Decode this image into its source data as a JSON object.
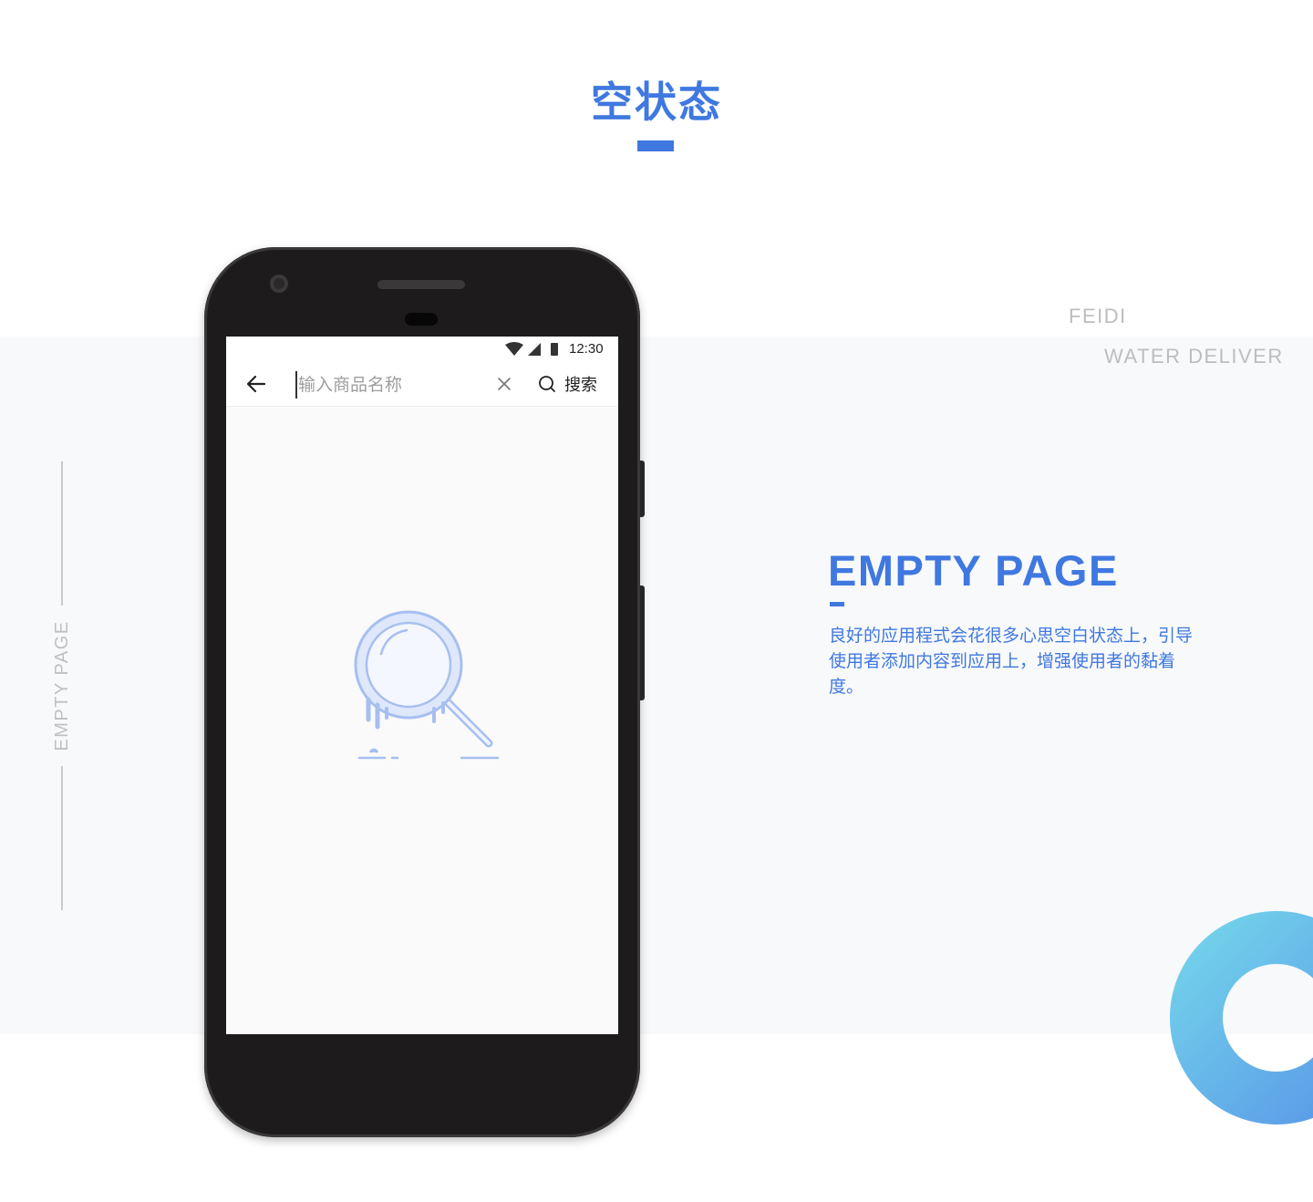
{
  "header": {
    "title": "空状态"
  },
  "brand": {
    "line1": "FEIDI",
    "line2": "WATER DELIVER"
  },
  "side_label": "EMPTY PAGE",
  "section": {
    "heading": "EMPTY PAGE",
    "description": "良好的应用程式会花很多心思空白状态上，引导使用者添加内容到应用上，增强使用者的黏着度。"
  },
  "phone": {
    "status_bar": {
      "time": "12:30",
      "icons": [
        "wifi-icon",
        "cell-signal-icon",
        "battery-icon"
      ]
    },
    "search": {
      "back_icon": "arrow-left-icon",
      "placeholder": "输入商品名称",
      "value": "",
      "clear_icon": "close-icon",
      "button_icon": "search-icon",
      "button_label": "搜索"
    },
    "empty_state": {
      "illustration_icon": "magnifier-illustration-icon"
    }
  },
  "colors": {
    "accent": "#3f78e0",
    "band_background": "#f8f9fb",
    "phone_body": "#1d1b1b",
    "illustration_stroke": "#a7bff0",
    "illustration_fill": "#dfe8fb",
    "ring_gradient_start": "#72d1ea",
    "ring_gradient_end": "#5a9ae8",
    "muted_text": "#bdbdbd"
  }
}
